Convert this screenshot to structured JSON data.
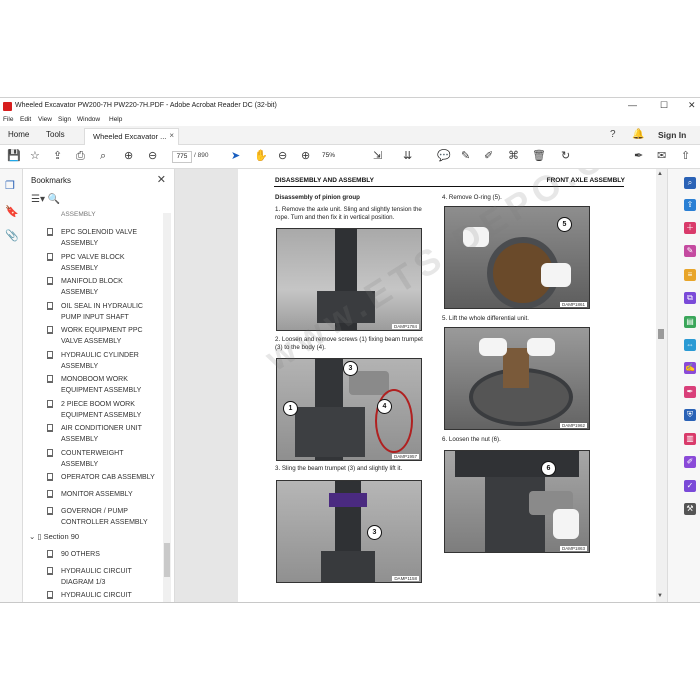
{
  "window": {
    "title": "Wheeled Excavator PW200-7H PW220-7H.PDF - Adobe Acrobat Reader DC (32-bit)",
    "controls": [
      "—",
      "☐",
      "✕"
    ]
  },
  "menu": [
    "File",
    "Edit",
    "View",
    "Sign",
    "Window",
    "Help"
  ],
  "tabs": {
    "home": "Home",
    "tools": "Tools",
    "doc": "Wheeled Excavator ...",
    "close": "×",
    "sign_in": "Sign In"
  },
  "toolbar": {
    "page_current": "775",
    "page_total": "/ 890",
    "zoom": "75%"
  },
  "sidebar": {
    "title": "Bookmarks",
    "close": "✕",
    "partial_top": "ASSEMBLY",
    "items": [
      "EPC SOLENOID VALVE ASSEMBLY",
      "PPC VALVE BLOCK ASSEMBLY",
      "MANIFOLD BLOCK ASSEMBLY",
      "OIL SEAL IN HYDRAULIC PUMP INPUT SHAFT",
      "WORK EQUIPMENT PPC VALVE ASSEMBLY",
      "HYDRAULIC CYLINDER ASSEMBLY",
      "MONOBOOM WORK EQUIPMENT ASSEMBLY",
      "2 PIECE BOOM WORK EQUIPMENT ASSEMBLY",
      "AIR CONDITIONER UNIT ASSEMBLY",
      "COUNTERWEIGHT ASSEMBLY",
      "OPERATOR CAB ASSEMBLY",
      "MONITOR ASSEMBLY",
      "GOVERNOR / PUMP CONTROLLER ASSEMBLY"
    ],
    "section": "Section 90",
    "section_items": [
      "90 OTHERS",
      "HYDRAULIC CIRCUIT DIAGRAM 1/3",
      "HYDRAULIC CIRCUIT"
    ]
  },
  "page": {
    "header_left": "DISASSEMBLY AND ASSEMBLY",
    "header_right": "FRONT AXLE ASSEMBLY",
    "section_title": "Disassembly of pinion group",
    "steps": {
      "s1": "1.  Remove the axle unit. Sling and slightly tension the rope. Turn and then fix it in vertical position.",
      "s2": "2.  Loosen and remove screws (1) fixing beam trumpet (3) to the body (4).",
      "s3": "3.  Sling the beam trumpet (3) and slightly lift it.",
      "s4": "4.  Remove O-ring (5).",
      "s5": "5.  Lift the whole differential unit.",
      "s6": "6.  Loosen the nut (6)."
    },
    "captions": {
      "p1": "DAMP1784",
      "p2": "DAMP1957",
      "p3": "DAMP1158",
      "p4": "DAMP1861",
      "p5": "DAMP1962",
      "p6": "DAMP1863"
    },
    "callouts": {
      "c1": "1",
      "c3a": "3",
      "c4": "4",
      "c3b": "3",
      "c5": "5",
      "c6": "6"
    },
    "watermark": "www.ETS DEPO.COM"
  }
}
